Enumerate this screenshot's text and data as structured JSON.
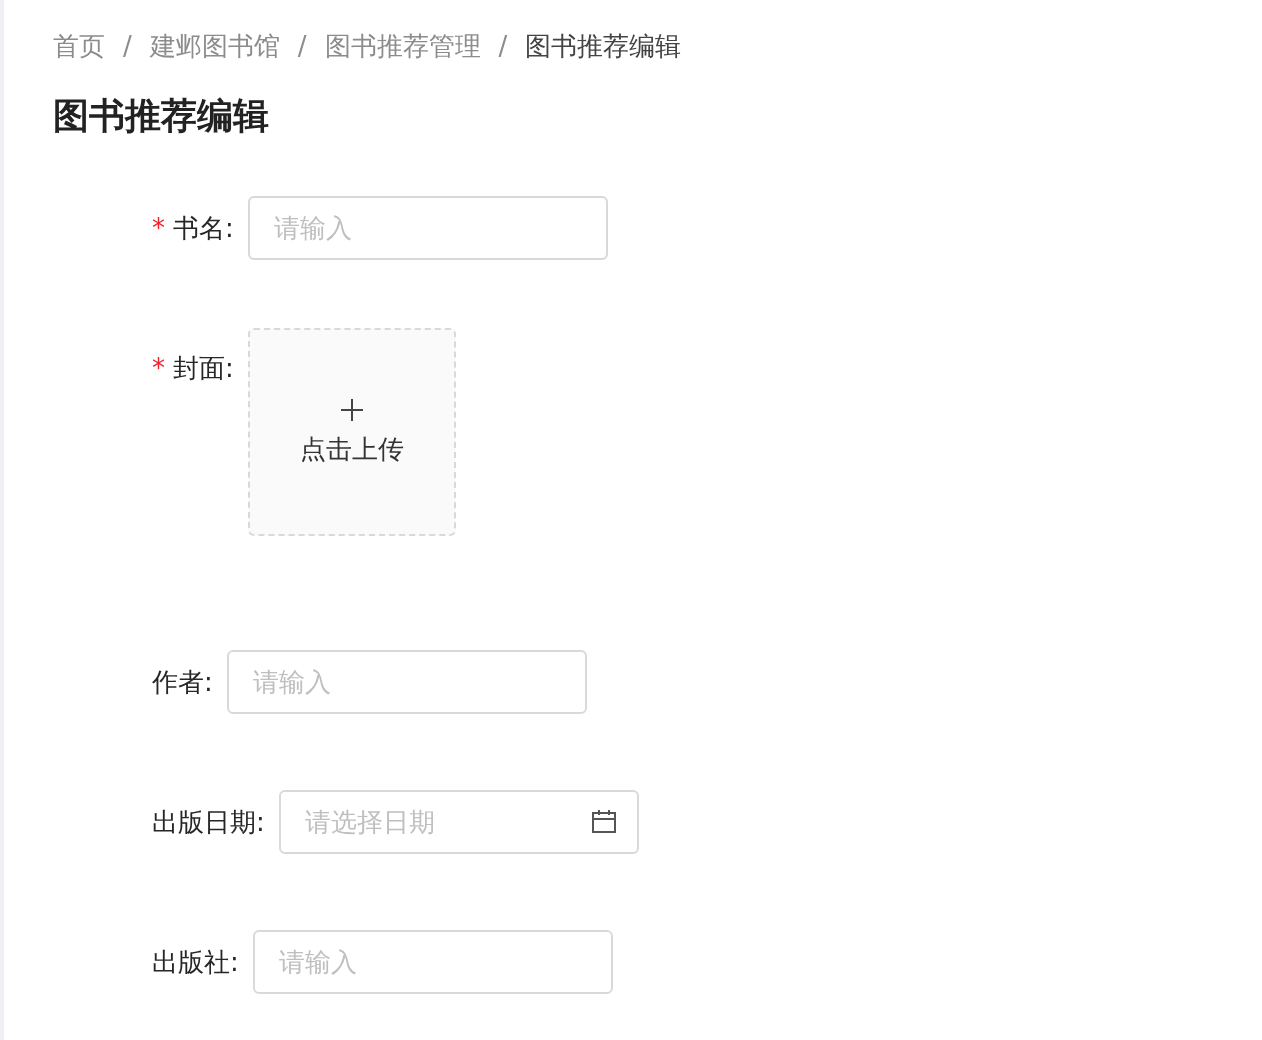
{
  "breadcrumb": [
    {
      "label": "首页",
      "current": false
    },
    {
      "label": "建邺图书馆",
      "current": false
    },
    {
      "label": "图书推荐管理",
      "current": false
    },
    {
      "label": "图书推荐编辑",
      "current": true
    }
  ],
  "breadcrumb_separator": "/",
  "title": "图书推荐编辑",
  "fields": [
    {
      "kind": "text",
      "label": "书名:",
      "required": true,
      "placeholder": "请输入"
    },
    {
      "kind": "upload",
      "label": "封面:",
      "required": true,
      "upload_text": "点击上传"
    },
    {
      "kind": "text",
      "label": "作者:",
      "required": false,
      "placeholder": "请输入"
    },
    {
      "kind": "date",
      "label": "出版日期:",
      "required": false,
      "placeholder": "请选择日期"
    },
    {
      "kind": "text",
      "label": "出版社:",
      "required": false,
      "placeholder": "请输入"
    }
  ],
  "required_mark": "*"
}
